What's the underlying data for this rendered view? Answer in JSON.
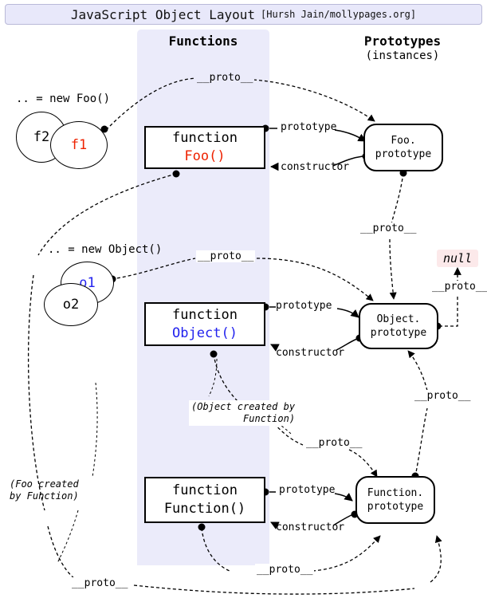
{
  "title": {
    "main": "JavaScript Object Layout",
    "credit": "[Hursh Jain/mollypages.org]"
  },
  "columns": {
    "functions": {
      "heading": "Functions"
    },
    "prototypes": {
      "heading": "Prototypes",
      "subheading": "(instances)"
    }
  },
  "nodes": {
    "foo_fn": {
      "line1": "function",
      "line2": "Foo()",
      "line2_color": "#ee2200"
    },
    "object_fn": {
      "line1": "function",
      "line2": "Object()",
      "line2_color": "#2222ee"
    },
    "function_fn": {
      "line1": "function",
      "line2": "Function()",
      "line2_color": "#000000"
    },
    "foo_proto": {
      "line1": "Foo.",
      "line2": "prototype"
    },
    "object_proto": {
      "line1": "Object.",
      "line2": "prototype"
    },
    "function_proto": {
      "line1": "Function.",
      "line2": "prototype"
    },
    "null_node": {
      "label": "null",
      "bg": "#fce9ea"
    }
  },
  "instances": {
    "foo": {
      "caption": ".. = new Foo()",
      "circles": [
        {
          "label": "f2",
          "color": "#000000"
        },
        {
          "label": "f1",
          "color": "#ee2200"
        }
      ]
    },
    "object": {
      "caption": ".. = new Object()",
      "circles": [
        {
          "label": "o1",
          "color": "#2222ee"
        },
        {
          "label": "o2",
          "color": "#000000"
        }
      ]
    }
  },
  "edge_labels": {
    "proto_f1_fooproto": "__proto__",
    "proto_o1_objproto": "__proto__",
    "proto_fooproto_objproto": "__proto__",
    "proto_objproto_null": "__proto__",
    "proto_objfn_funcproto": "__proto__",
    "proto_funcfn_funcproto": "__proto__",
    "proto_funcproto_objproto": "__proto__",
    "proto_foofn_funcproto": "__proto__",
    "foo_prototype": "prototype",
    "foo_constructor": "constructor",
    "object_prototype": "prototype",
    "object_constructor": "constructor",
    "function_prototype": "prototype",
    "function_constructor": "constructor"
  },
  "notes": {
    "object_created": "(Object created by\n        Function)",
    "foo_created": "(Foo created\nby Function)"
  },
  "colors": {
    "band": "#ebebfa",
    "titlebar": "#e8e8fa",
    "red": "#ee2200",
    "blue": "#2222ee",
    "null_bg": "#fce9ea"
  }
}
